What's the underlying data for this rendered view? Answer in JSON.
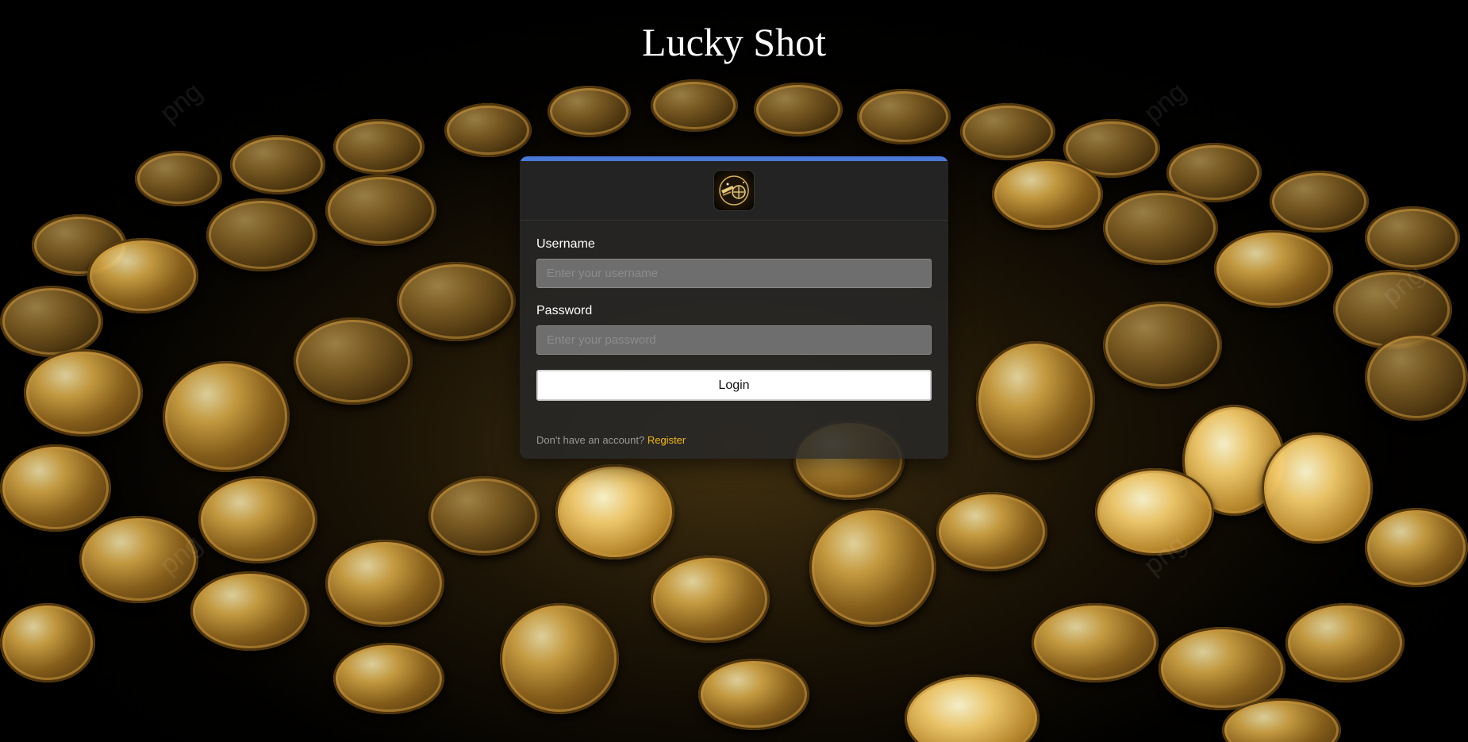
{
  "page": {
    "title": "Lucky Shot"
  },
  "login_form": {
    "username_label": "Username",
    "username_placeholder": "Enter your username",
    "username_value": "",
    "password_label": "Password",
    "password_placeholder": "Enter your password",
    "password_value": "",
    "login_button_label": "Login",
    "no_account_text": "Don't have an account?",
    "register_link_label": "Register"
  },
  "colors": {
    "accent_bar": "#4a78d6",
    "register_link": "#f0b90b",
    "card_background": "#282828"
  },
  "icons": {
    "logo": "lucky-shot-logo-icon"
  },
  "background": {
    "description_icon": "gold-coins-background"
  }
}
